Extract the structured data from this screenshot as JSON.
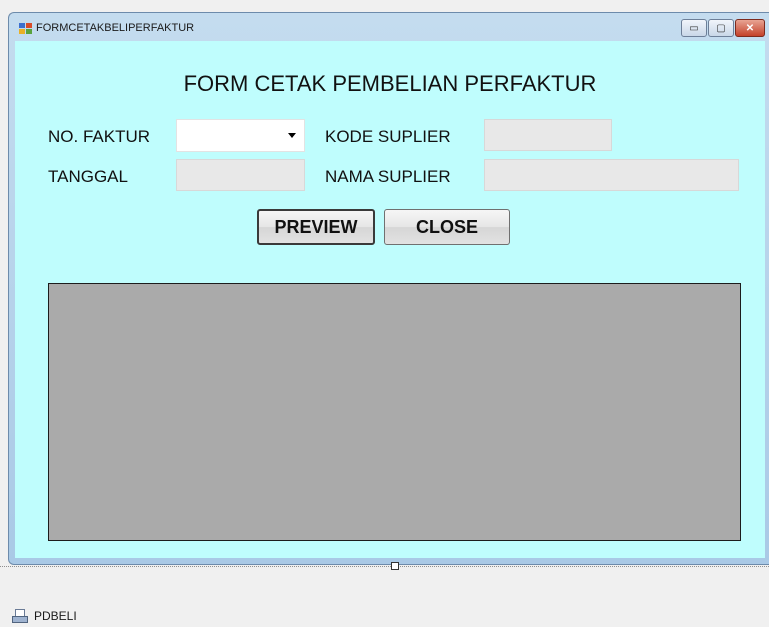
{
  "window": {
    "title": "FORMCETAKBELIPERFAKTUR",
    "controls": {
      "minimize": "▭",
      "maximize": "▢",
      "close": "✕"
    }
  },
  "form": {
    "heading": "FORM CETAK PEMBELIAN PERFAKTUR",
    "no_faktur_label": "NO. FAKTUR",
    "no_faktur_value": "",
    "tanggal_label": "TANGGAL",
    "tanggal_value": "",
    "kode_suplier_label": "KODE SUPLIER",
    "kode_suplier_value": "",
    "nama_suplier_label": "NAMA SUPLIER",
    "nama_suplier_value": "",
    "preview_label": "PREVIEW",
    "close_label": "CLOSE"
  },
  "tray": {
    "component_label": "PDBELI"
  },
  "colors": {
    "client_background": "#bffdfd",
    "viewer_background": "#aaaaaa",
    "textbox_disabled": "#e8e8e8"
  }
}
